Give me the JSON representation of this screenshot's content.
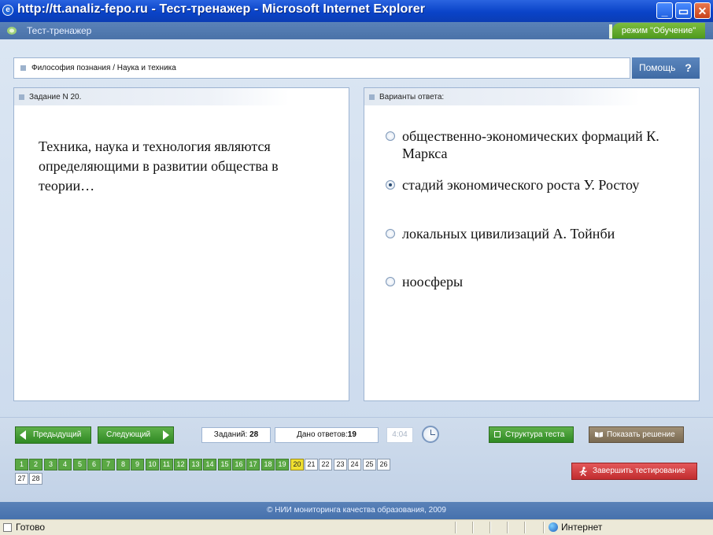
{
  "window": {
    "title": "http://tt.analiz-fepo.ru - Тест-тренажер - Microsoft Internet Explorer",
    "buttons": {
      "minimize": "_",
      "maximize": "▭",
      "close": "✕"
    }
  },
  "app": {
    "title": "Тест-тренажер",
    "mode_badge": "режим \"Обучение\""
  },
  "breadcrumb": "Философия познания / Наука и техника",
  "help": {
    "label": "Помощь",
    "icon": "?"
  },
  "task": {
    "header": "Задание N 20.",
    "question": "Техника, наука и технология являются определяющими в развитии общества в теории…"
  },
  "answers": {
    "header": "Варианты ответа:",
    "options": [
      {
        "text": "общественно-экономических формаций К. Маркса",
        "selected": false
      },
      {
        "text": "стадий экономического роста У. Ростоу",
        "selected": true
      },
      {
        "text": "локальных  цивилизаций А. Тойнби",
        "selected": false
      },
      {
        "text": "ноосферы",
        "selected": false
      }
    ]
  },
  "nav": {
    "prev_label": "Предыдущий",
    "next_label": "Следующий",
    "tasks_label": "Заданий:",
    "tasks_count": "28",
    "answers_label": "Дано ответов:",
    "answers_count": "19",
    "timer": "4:04",
    "structure_label": "Структура теста",
    "solution_label": "Показать решение",
    "finish_label": "Завершить тестирование"
  },
  "question_numbers": {
    "answered": [
      "1",
      "2",
      "3",
      "4",
      "5",
      "6",
      "7",
      "8",
      "9",
      "10",
      "11",
      "12",
      "13",
      "14",
      "15",
      "16",
      "17",
      "18",
      "19"
    ],
    "current": "20",
    "pending": [
      "21",
      "22",
      "23",
      "24",
      "25",
      "26",
      "27",
      "28"
    ]
  },
  "footer": "© НИИ мониторинга качества образования, 2009",
  "statusbar": {
    "status": "Готово",
    "zone": "Интернет"
  },
  "colors": {
    "header_blue": "#4a72a8",
    "answered_green": "#5aa844",
    "current_yellow": "#f0e030",
    "finish_red": "#c12d2f"
  }
}
